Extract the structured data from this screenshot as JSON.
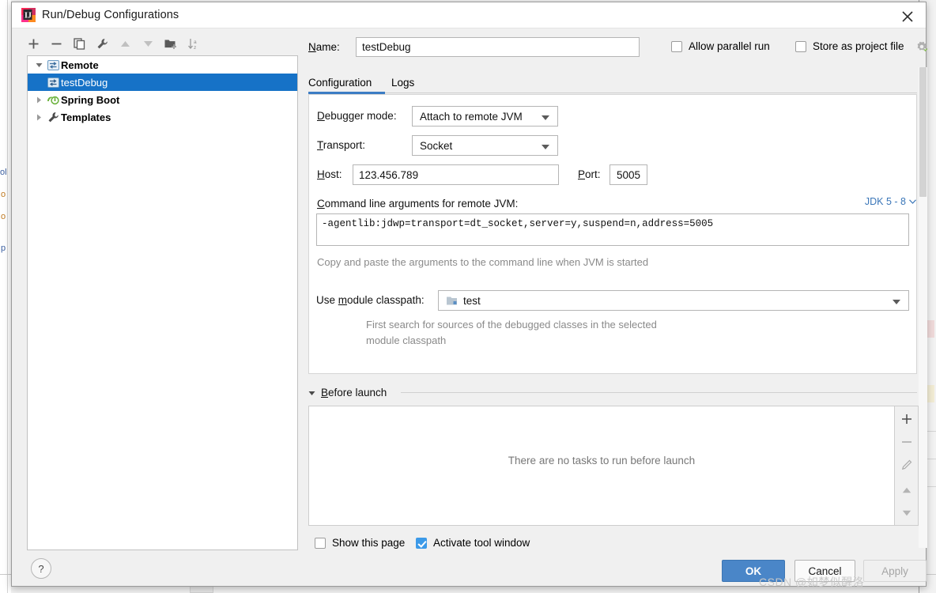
{
  "window": {
    "title": "Run/Debug Configurations",
    "app_icon": "intellij-idea-icon",
    "close_icon": "close-icon"
  },
  "tree_toolbar": {
    "buttons": [
      {
        "name": "add-configuration-button",
        "icon": "plus-icon"
      },
      {
        "name": "remove-configuration-button",
        "icon": "minus-icon"
      },
      {
        "name": "copy-configuration-button",
        "icon": "copy-icon"
      },
      {
        "name": "edit-templates-button",
        "icon": "wrench-icon"
      },
      {
        "name": "move-up-button",
        "icon": "arrow-up-icon"
      },
      {
        "name": "move-down-button",
        "icon": "arrow-down-icon"
      },
      {
        "name": "create-folder-button",
        "icon": "new-folder-icon"
      },
      {
        "name": "sort-configurations-button",
        "icon": "sort-alpha-icon"
      }
    ]
  },
  "tree": {
    "items": [
      {
        "label": "Remote",
        "icon": "remote-icon",
        "arrow": "expanded",
        "bold": true,
        "indent": 0,
        "selected": false
      },
      {
        "label": "testDebug",
        "icon": "remote-icon",
        "arrow": "none",
        "bold": false,
        "indent": 1,
        "selected": true
      },
      {
        "label": "Spring Boot",
        "icon": "spring-boot-icon",
        "arrow": "collapsed",
        "bold": true,
        "indent": 0,
        "selected": false
      },
      {
        "label": "Templates",
        "icon": "wrench-icon",
        "arrow": "collapsed",
        "bold": true,
        "indent": 0,
        "selected": false
      }
    ]
  },
  "help": {
    "label": "?",
    "icon": "help-icon"
  },
  "header": {
    "name_label": "Name:",
    "name_label_mnemonic": "N",
    "name_value": "testDebug",
    "name_placeholder": "Name",
    "allow_parallel_run": {
      "label": "Allow parallel run",
      "checked": false
    },
    "store_as_project_file": {
      "label": "Store as project file",
      "checked": false
    },
    "store_settings_icon": "gear-icon"
  },
  "tabs": [
    {
      "label": "Configuration",
      "active": true
    },
    {
      "label": "Logs",
      "active": false
    }
  ],
  "configuration": {
    "debugger_mode": {
      "label": "Debugger mode:",
      "mnemonic": "D",
      "value": "Attach to remote JVM"
    },
    "transport": {
      "label": "Transport:",
      "mnemonic": "T",
      "value": "Socket"
    },
    "host": {
      "label": "Host:",
      "mnemonic": "H",
      "value": "123.456.789"
    },
    "port": {
      "label": "Port:",
      "mnemonic": "P",
      "value": "5005"
    },
    "command_line_args": {
      "label": "Command line arguments for remote JVM:",
      "mnemonic": "C",
      "value": "-agentlib:jdwp=transport=dt_socket,server=y,suspend=n,address=5005",
      "hint": "Copy and paste the arguments to the command line when JVM is started",
      "jdk_selector": "JDK 5 - 8",
      "jdk_caret_icon": "chevron-down-icon"
    },
    "module_classpath": {
      "label": "Use module classpath:",
      "mnemonic": "m",
      "value": "test",
      "icon": "module-icon",
      "hint_line1": "First search for sources of the debugged classes in the selected",
      "hint_line2": "module classpath"
    }
  },
  "before_launch": {
    "title": "Before launch",
    "mnemonic": "B",
    "collapse_icon": "triangle-down-icon",
    "empty_message": "There are no tasks to run before launch",
    "side_buttons": [
      {
        "name": "add-task-button",
        "icon": "plus-icon"
      },
      {
        "name": "remove-task-button",
        "icon": "minus-icon"
      },
      {
        "name": "edit-task-button",
        "icon": "pencil-icon"
      },
      {
        "name": "move-task-up-button",
        "icon": "arrow-up-icon"
      },
      {
        "name": "move-task-down-button",
        "icon": "arrow-down-icon"
      }
    ]
  },
  "footer": {
    "show_this_page": {
      "label": "Show this page",
      "checked": false
    },
    "activate_tool_window": {
      "label": "Activate tool window",
      "checked": true
    },
    "ok_label": "OK",
    "cancel_label": "Cancel",
    "apply_label": "Apply"
  },
  "watermark": "CSDN @如梦似醒洛",
  "backdrop": {
    "gutter_tokens": [
      "ol",
      "o",
      "o",
      "p"
    ]
  },
  "colors": {
    "accent": "#1672c7",
    "ok_button": "#4a86c8",
    "tab_underline": "#3c7cc4",
    "link": "#3a76b8",
    "checkbox_checked": "#3c9ae8",
    "hint_text": "#8a8a8a"
  }
}
